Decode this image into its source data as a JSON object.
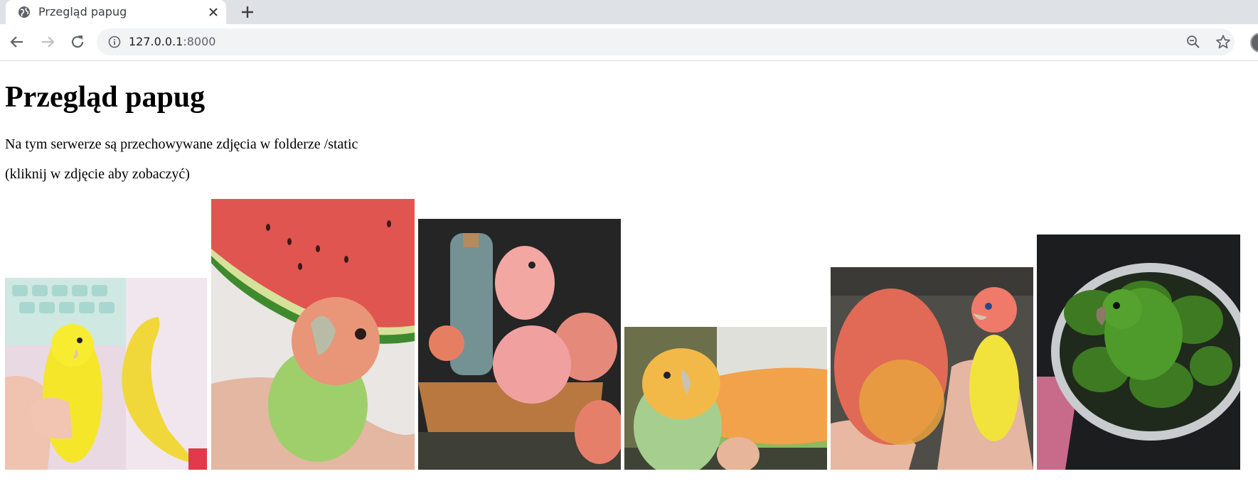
{
  "browser": {
    "tab_title": "Przegląd papug",
    "url_host": "127.0.0.1",
    "url_port": ":8000"
  },
  "page": {
    "title": "Przegląd papug",
    "description": "Na tym serwerze są przechowywane zdjęcia w folderze /static",
    "hint": "(kliknij w zdjęcie aby zobaczyć)"
  },
  "photos": [
    {
      "subject": "yellow parakeet with banana"
    },
    {
      "subject": "lovebird with watermelon"
    },
    {
      "subject": "pink bird on peaches"
    },
    {
      "subject": "lovebird with melon"
    },
    {
      "subject": "lovebird with mango"
    },
    {
      "subject": "green parrot with avocados"
    }
  ],
  "colors": {
    "tabstrip": "#dee1e6",
    "omnibox": "#f1f3f4"
  }
}
